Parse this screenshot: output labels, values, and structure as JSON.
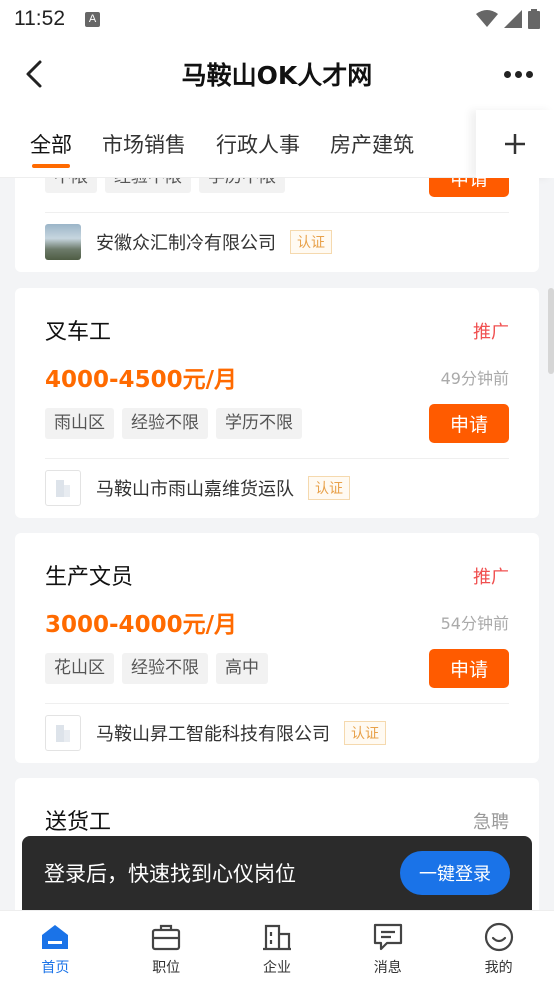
{
  "status_bar": {
    "time": "11:52",
    "a_icon": "A"
  },
  "navbar": {
    "title": "马鞍山OK人才网"
  },
  "tabs": [
    {
      "label": "全部"
    },
    {
      "label": "市场销售"
    },
    {
      "label": "行政人事"
    },
    {
      "label": "房产建筑"
    }
  ],
  "partial_card": {
    "chips": [
      "不限",
      "经验不限",
      "学历不限"
    ],
    "apply_label": "申请",
    "company": "安徽众汇制冷有限公司",
    "verified": "认证"
  },
  "jobs": [
    {
      "title": "叉车工",
      "tag": "推广",
      "salary": "4000-4500元/月",
      "time": "49分钟前",
      "chips": [
        "雨山区",
        "经验不限",
        "学历不限"
      ],
      "apply_label": "申请",
      "company": "马鞍山市雨山嘉维货运队",
      "verified": "认证"
    },
    {
      "title": "生产文员",
      "tag": "推广",
      "salary": "3000-4000元/月",
      "time": "54分钟前",
      "chips": [
        "花山区",
        "经验不限",
        "高中"
      ],
      "apply_label": "申请",
      "company": "马鞍山昇工智能科技有限公司",
      "verified": "认证"
    },
    {
      "title": "送货工",
      "tag": "急聘"
    }
  ],
  "toast": {
    "text": "登录后，快速找到心仪岗位",
    "button": "一键登录"
  },
  "bottom_nav": [
    {
      "label": "首页",
      "icon": "home-icon"
    },
    {
      "label": "职位",
      "icon": "briefcase-icon"
    },
    {
      "label": "企业",
      "icon": "building-icon"
    },
    {
      "label": "消息",
      "icon": "message-icon"
    },
    {
      "label": "我的",
      "icon": "profile-icon"
    }
  ],
  "colors": {
    "accent": "#ff6a00",
    "apply": "#ff5b00",
    "tag_promo": "#f05050",
    "primary_blue": "#1a73e8"
  }
}
